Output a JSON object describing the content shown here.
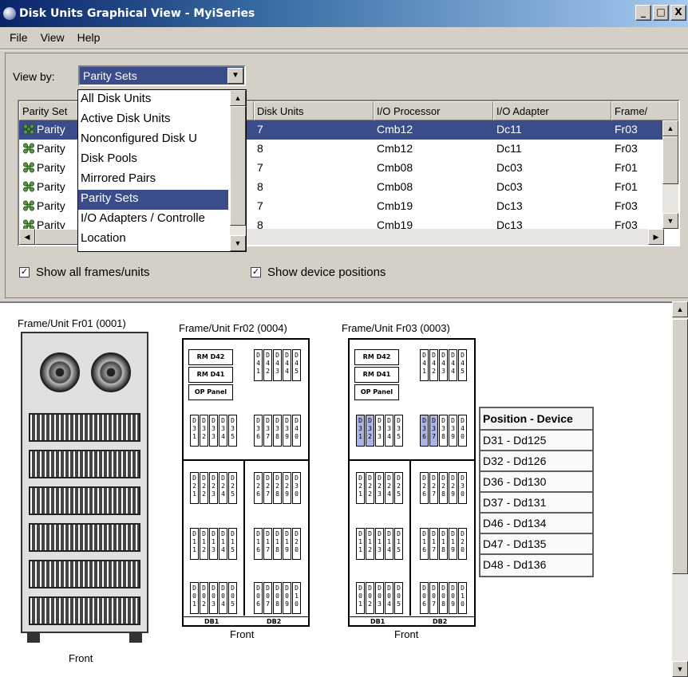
{
  "window": {
    "title": "Disk Units Graphical View - MyiSeries",
    "min_label": "_",
    "max_label": "□",
    "close_label": "X"
  },
  "menu": [
    "File",
    "View",
    "Help"
  ],
  "view_by": {
    "label": "View by:",
    "value": "Parity Sets",
    "options": [
      "All Disk Units",
      "Active Disk Units",
      "Nonconfigured Disk U",
      "Disk Pools",
      "Mirrored Pairs",
      "Parity Sets",
      "I/O Adapters / Controlle",
      "Location"
    ]
  },
  "table": {
    "columns": [
      "Parity Set",
      "",
      "Disk Units",
      "I/O Processor",
      "I/O Adapter",
      "Frame/"
    ],
    "rows": [
      {
        "name": "Parity",
        "units": "7",
        "iop": "Cmb12",
        "ioa": "Dc11",
        "frame": "Fr03"
      },
      {
        "name": "Parity",
        "units": "8",
        "iop": "Cmb12",
        "ioa": "Dc11",
        "frame": "Fr03"
      },
      {
        "name": "Parity",
        "units": "7",
        "iop": "Cmb08",
        "ioa": "Dc03",
        "frame": "Fr01"
      },
      {
        "name": "Parity",
        "units": "8",
        "iop": "Cmb08",
        "ioa": "Dc03",
        "frame": "Fr01"
      },
      {
        "name": "Parity",
        "units": "7",
        "iop": "Cmb19",
        "ioa": "Dc13",
        "frame": "Fr03"
      },
      {
        "name": "Parity",
        "units": "8",
        "iop": "Cmb19",
        "ioa": "Dc13",
        "frame": "Fr03"
      }
    ]
  },
  "checkboxes": {
    "show_all": "Show all frames/units",
    "show_positions": "Show device positions"
  },
  "frames": {
    "fr01": {
      "title": "Frame/Unit Fr01 (0001)",
      "front": "Front"
    },
    "fr02": {
      "title": "Frame/Unit Fr02 (0004)",
      "front": "Front"
    },
    "fr03": {
      "title": "Frame/Unit Fr03 (0003)",
      "front": "Front"
    }
  },
  "frame_labels": {
    "rm1": "RM D42",
    "rm2": "RM D41",
    "op": "OP Panel",
    "db1": "DB1",
    "db2": "DB2"
  },
  "banks": {
    "top_right": [
      "D41",
      "D42",
      "D43",
      "D44",
      "D45"
    ],
    "row2_left": [
      "D31",
      "D32",
      "D33",
      "D34",
      "D35"
    ],
    "row2_right": [
      "D36",
      "D37",
      "D38",
      "D39",
      "D40"
    ],
    "row3_left": [
      "D21",
      "D22",
      "D23",
      "D24",
      "D25"
    ],
    "row3_right": [
      "D26",
      "D27",
      "D28",
      "D29",
      "D30"
    ],
    "row4_left": [
      "D11",
      "D12",
      "D13",
      "D14",
      "D15"
    ],
    "row4_right": [
      "D16",
      "D17",
      "D18",
      "D19",
      "D20"
    ],
    "row5_left": [
      "D01",
      "D02",
      "D03",
      "D04",
      "D05"
    ],
    "row5_right": [
      "D06",
      "D07",
      "D08",
      "D09",
      "D10"
    ]
  },
  "highlighted_fr03": [
    "D31",
    "D32",
    "D36",
    "D37",
    "D46",
    "D47",
    "D48"
  ],
  "position_table": {
    "header": "Position - Device",
    "rows": [
      "D31 - Dd125",
      "D32 - Dd126",
      "D36 - Dd130",
      "D37 - Dd131",
      "D46 - Dd134",
      "D47 - Dd135",
      "D48 - Dd136"
    ]
  },
  "colors": {
    "selection": "#3a4d8a",
    "highlight": "#a9b4e8"
  }
}
